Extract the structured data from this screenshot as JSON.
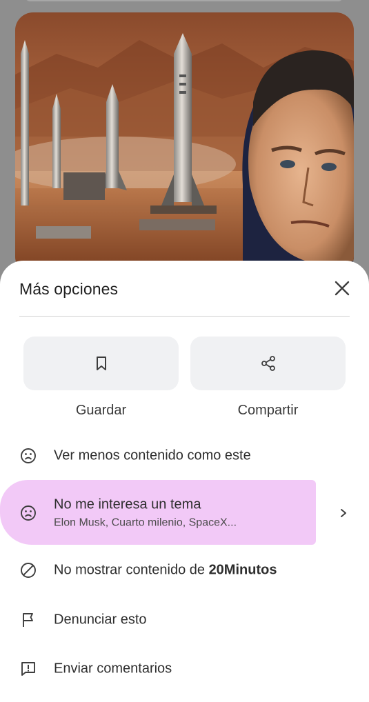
{
  "hero": {
    "alt": "Elon Musk con cohetes SpaceX en un paisaje marciano"
  },
  "sheet": {
    "title": "Más opciones",
    "actions": [
      {
        "label": "Guardar",
        "icon": "bookmark-icon"
      },
      {
        "label": "Compartir",
        "icon": "share-icon"
      }
    ],
    "options": [
      {
        "icon": "sad-face-icon",
        "label": "Ver menos contenido como este"
      },
      {
        "icon": "sad-face-icon",
        "label": "No me interesa un tema",
        "sublabel": "Elon Musk, Cuarto milenio, SpaceX...",
        "highlighted": true
      },
      {
        "icon": "block-icon",
        "label_prefix": "No mostrar contenido de ",
        "label_bold": "20Minutos"
      },
      {
        "icon": "flag-icon",
        "label": "Denunciar esto"
      },
      {
        "icon": "feedback-icon",
        "label": "Enviar comentarios"
      }
    ]
  },
  "colors": {
    "highlight": "#f2c9f7",
    "button_bg": "#f0f1f3",
    "sheet_bg": "#ffffff",
    "scrim": "#8e8e8e"
  }
}
